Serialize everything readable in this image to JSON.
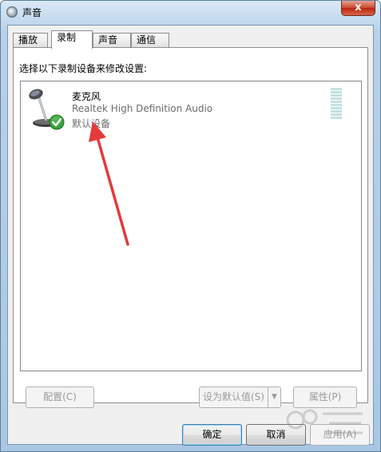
{
  "window": {
    "title": "声音",
    "close_glyph": "x"
  },
  "tabs": [
    {
      "label": "播放",
      "active": false
    },
    {
      "label": "录制",
      "active": true
    },
    {
      "label": "声音",
      "active": false
    },
    {
      "label": "通信",
      "active": false
    }
  ],
  "panel": {
    "instruction": "选择以下录制设备来修改设置:"
  },
  "devices": [
    {
      "name": "麦克风",
      "driver": "Realtek High Definition Audio",
      "status": "默认设备",
      "icon": "microphone-icon",
      "default_badge_icon": "checkmark-icon",
      "level_bars": 10
    }
  ],
  "buttons": {
    "configure": "配置(C)",
    "set_default": "设为默认值(S)",
    "properties": "属性(P)",
    "ok": "确定",
    "cancel": "取消",
    "apply": "应用(A)"
  },
  "colors": {
    "annotation_arrow": "#e23b3b",
    "level_meter": "#c6dfe0",
    "check_badge": "#3aa33a"
  }
}
